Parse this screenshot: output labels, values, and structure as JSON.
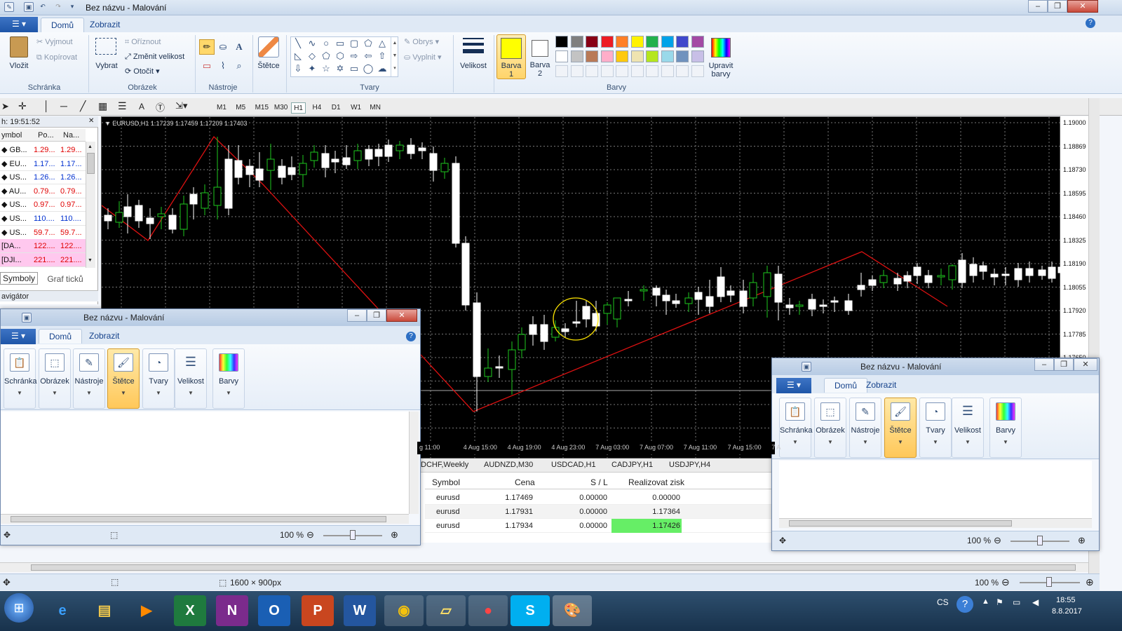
{
  "app": {
    "title": "Bez názvu - Malování"
  },
  "ribbon": {
    "tabs": [
      "Domů",
      "Zobrazit"
    ],
    "clipboard": {
      "paste": "Vložit",
      "cut": "Vyjmout",
      "copy": "Kopírovat",
      "label": "Schránka"
    },
    "image": {
      "select": "Vybrat",
      "crop": "Oříznout",
      "resize": "Změnit velikost",
      "rotate": "Otočit",
      "label": "Obrázek"
    },
    "tools": {
      "label": "Nástroje"
    },
    "brushes": {
      "label": "Štětce"
    },
    "shapes": {
      "outline": "Obrys",
      "fill": "Vyplnit",
      "label": "Tvary"
    },
    "size": {
      "label": "Velikost"
    },
    "color1": {
      "label1": "Barva",
      "label2": "1",
      "value": "#ffff00"
    },
    "color2": {
      "label1": "Barva",
      "label2": "2",
      "value": "#ffffff"
    },
    "edit_colors": {
      "label1": "Upravit",
      "label2": "barvy"
    },
    "colors": {
      "label": "Barvy",
      "palette": [
        "#000000",
        "#7f7f7f",
        "#880015",
        "#ed1c24",
        "#ff7f27",
        "#fff200",
        "#22b14c",
        "#00a2e8",
        "#3f48cc",
        "#a349a4",
        "#ffffff",
        "#c3c3c3",
        "#b97a57",
        "#ffaec9",
        "#ffc90e",
        "#efe4b0",
        "#b5e61d",
        "#99d9ea",
        "#7092be",
        "#c8bfe7"
      ]
    }
  },
  "mt4": {
    "timeframes": [
      "M1",
      "M5",
      "M15",
      "M30",
      "H1",
      "H4",
      "D1",
      "W1",
      "MN"
    ],
    "active_tf": "H1",
    "market_watch": {
      "time": "h: 19:51:52",
      "headers": [
        "ymbol",
        "Po...",
        "Na..."
      ],
      "rows": [
        {
          "sym": "GB...",
          "bid": "1.29...",
          "ask": "1.29...",
          "color": "#e00000"
        },
        {
          "sym": "EU...",
          "bid": "1.17...",
          "ask": "1.17...",
          "color": "#0030d0"
        },
        {
          "sym": "US...",
          "bid": "1.26...",
          "ask": "1.26...",
          "color": "#0030d0"
        },
        {
          "sym": "AU...",
          "bid": "0.79...",
          "ask": "0.79...",
          "color": "#e00000"
        },
        {
          "sym": "US...",
          "bid": "0.97...",
          "ask": "0.97...",
          "color": "#e00000"
        },
        {
          "sym": "US...",
          "bid": "110....",
          "ask": "110....",
          "color": "#0030d0"
        },
        {
          "sym": "US...",
          "bid": "59.7...",
          "ask": "59.7...",
          "color": "#e00000"
        },
        {
          "sym": "[DA...",
          "bid": "122....",
          "ask": "122....",
          "color": "#e00000"
        },
        {
          "sym": "[DJI...",
          "bid": "221....",
          "ask": "221....",
          "color": "#e00000"
        }
      ],
      "tabs": [
        "Symboly",
        "Graf ticků"
      ]
    },
    "navigator": "avigátor",
    "chart_info": "EURUSD,H1  1.17239 1.17459 1.17209 1.17403",
    "prices": [
      "1.19000",
      "1.18869",
      "1.18730",
      "1.18595",
      "1.18460",
      "1.18325",
      "1.18190",
      "1.18055",
      "1.17920",
      "1.17785",
      "1.17650"
    ],
    "times": [
      "g 11:00",
      "4 Aug 15:00",
      "4 Aug 19:00",
      "4 Aug 23:00",
      "7 Aug 03:00",
      "7 Aug 07:00",
      "7 Aug 11:00",
      "7 Aug 15:00",
      "7 A"
    ],
    "symbol_tabs": [
      "DCHF,Weekly",
      "AUDNZD,M30",
      "USDCAD,H1",
      "CADJPY,H1",
      "USDJPY,H4"
    ],
    "trade": {
      "headers": [
        "Symbol",
        "Cena",
        "S / L",
        "Realizovat zisk"
      ],
      "rows": [
        [
          "eurusd",
          "1.17469",
          "0.00000",
          "0.00000"
        ],
        [
          "eurusd",
          "1.17931",
          "0.00000",
          "1.17364"
        ],
        [
          "eurusd",
          "1.17934",
          "0.00000",
          "1.17426"
        ]
      ]
    }
  },
  "paint_small": {
    "buttons": [
      "Schránka",
      "Obrázek",
      "Nástroje",
      "Štětce",
      "Tvary",
      "Velikost",
      "Barvy"
    ],
    "zoom": "100 %"
  },
  "status": {
    "size": "1600 × 900px",
    "zoom": "100 %"
  },
  "taskbar": {
    "lang": "CS",
    "time": "18:55",
    "date": "8.8.2017"
  }
}
